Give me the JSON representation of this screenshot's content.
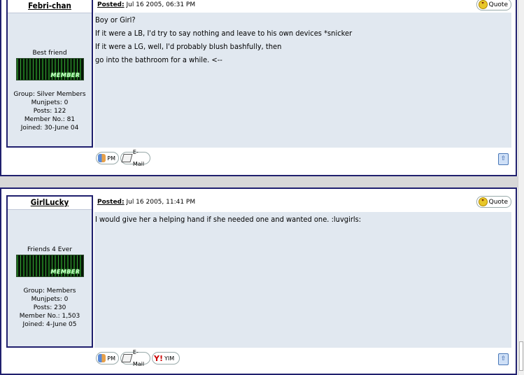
{
  "posts": [
    {
      "username": "Febri-chan",
      "title": "Best friend",
      "badge_text": "MEMBER",
      "group": "Group: Silver Members",
      "munjpets_label": "Munjpets:",
      "munjpets": "0",
      "posts": "Posts: 122",
      "member_no": "Member No.: 81",
      "joined": "Joined: 30-June 04",
      "posted_label": "Posted:",
      "posted_date": " Jul 16 2005, 06:31 PM",
      "quote_label": "Quote",
      "body_lines": [
        "Boy or Girl?",
        "",
        "If it were a LB, I'd try to say nothing and leave to his own devices *snicker",
        "",
        "If it were a LG, well, I'd probably blush bashfully, then",
        "go into the bathroom for a while. <--"
      ],
      "buttons": [
        "PM",
        "E-Mail"
      ]
    },
    {
      "username": "GirlLucky",
      "title": "Friends 4 Ever",
      "badge_text": "MEMBER",
      "group": "Group: Members",
      "munjpets_label": "Munjpets:",
      "munjpets": "0",
      "posts": "Posts: 230",
      "member_no": "Member No.: 1,503",
      "joined": "Joined: 4-June 05",
      "posted_label": "Posted:",
      "posted_date": " Jul 16 2005, 11:41 PM",
      "quote_label": "Quote",
      "body_lines": [
        "I would give her a helping hand if she needed one and wanted one. :luvgirls:"
      ],
      "buttons": [
        "PM",
        "E-Mail",
        "YIM"
      ]
    }
  ],
  "icons": {
    "quote": "quote-icon",
    "pm": "pm-icon",
    "email": "email-icon",
    "yim": "yim-icon",
    "top": "back-to-top-icon"
  }
}
